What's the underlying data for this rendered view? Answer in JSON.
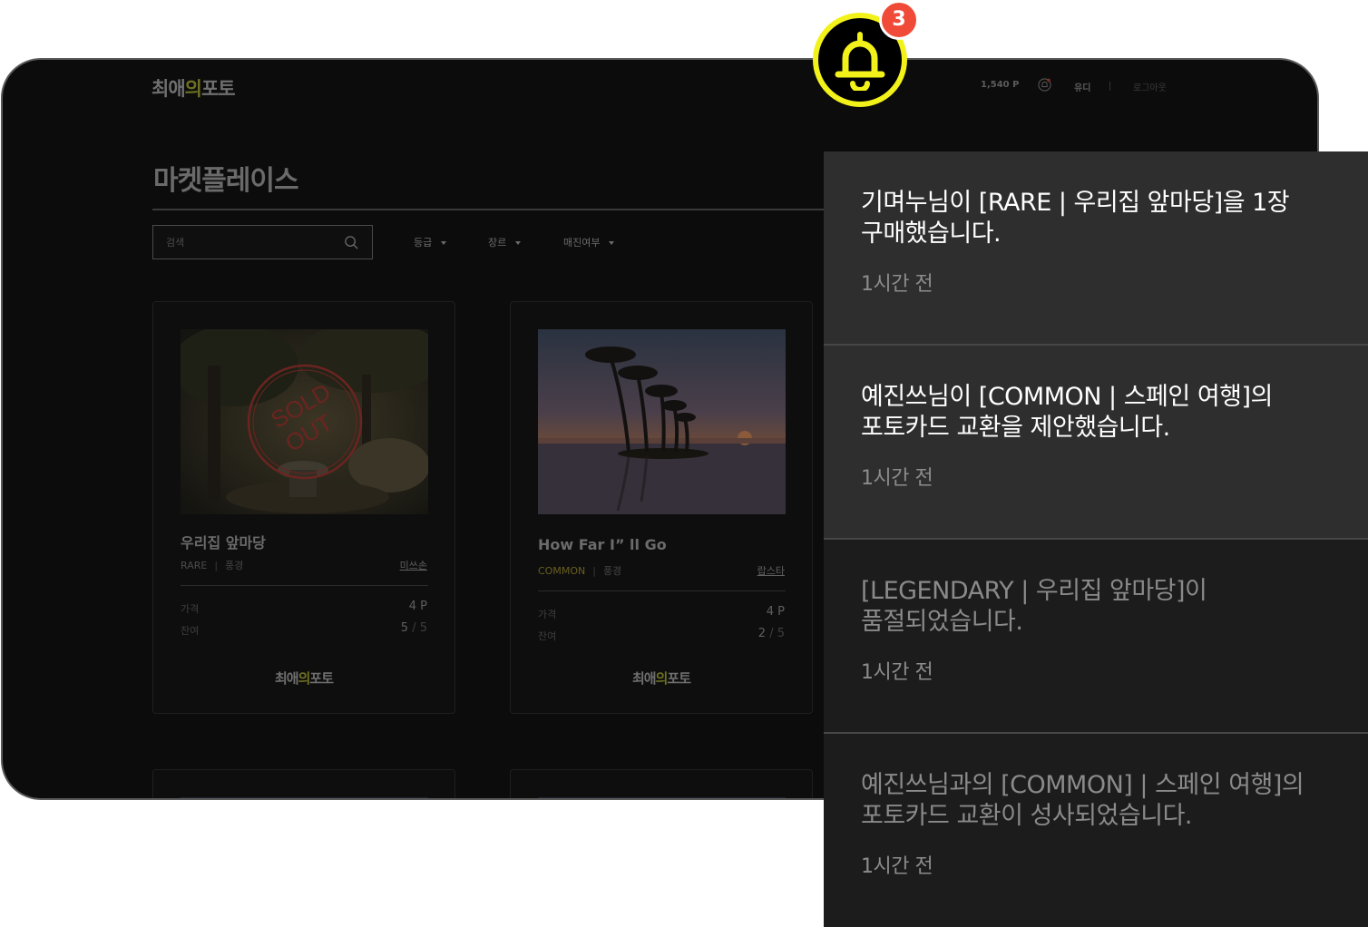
{
  "app": {
    "logo_parts": [
      "최애",
      "의",
      "포토"
    ]
  },
  "header": {
    "points": "1,540 P",
    "username": "유디",
    "logout_label": "로그아웃"
  },
  "page": {
    "title": "마켓플레이스"
  },
  "search": {
    "placeholder": "검색"
  },
  "filters": [
    {
      "label": "등급"
    },
    {
      "label": "장르"
    },
    {
      "label": "매진여부"
    }
  ],
  "cards": [
    {
      "title": "우리집 앞마당",
      "grade": "RARE",
      "genre": "풍경",
      "owner": "미쓰손",
      "price_label": "가격",
      "price": "4 P",
      "remaining_label": "잔여",
      "remaining": "5",
      "total": "/ 5",
      "sold_out": true,
      "sold_out_text": [
        "SOLD",
        "OUT"
      ]
    },
    {
      "title": "How Far I” ll Go",
      "grade": "COMMON",
      "genre": "풍경",
      "owner": "랍스타",
      "price_label": "가격",
      "price": "4 P",
      "remaining_label": "잔여",
      "remaining": "2",
      "total": "/ 5",
      "sold_out": false
    }
  ],
  "notifications": {
    "badge_count": "3",
    "items": [
      {
        "message": "기며누님이 [RARE | 우리집 앞마당]을 1장 구매했습니다.",
        "time": "1시간 전",
        "read": false
      },
      {
        "message": "예진쓰님이 [COMMON | 스페인 여행]의 포토카드 교환을 제안했습니다.",
        "time": "1시간 전",
        "read": false
      },
      {
        "message": "[LEGENDARY | 우리집 앞마당]이 품절되었습니다.",
        "time": "1시간 전",
        "read": true
      },
      {
        "message": "예진쓰님과의 [COMMON] | 스페인 여행]의 포토카드 교환이 성사되었습니다.",
        "time": "1시간 전",
        "read": true
      }
    ]
  },
  "colors": {
    "accent": "#f2f21a",
    "badge": "#f04b38",
    "unread_bg": "#2e2e2e",
    "read_bg": "#1c1c1c"
  }
}
